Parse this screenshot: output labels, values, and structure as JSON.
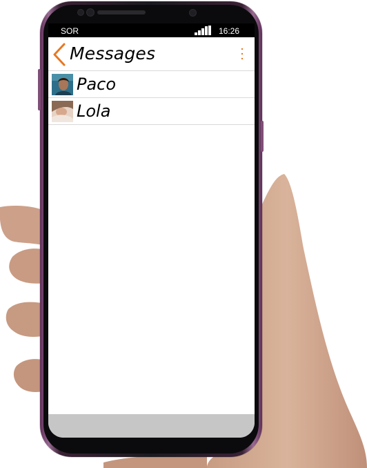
{
  "status_bar": {
    "carrier": "SOR",
    "time": "16:26"
  },
  "header": {
    "title": "Messages",
    "back_icon": "chevron-left-icon",
    "menu_icon": "vertical-dots-icon"
  },
  "conversations": [
    {
      "name": "Paco",
      "avatar": "avatar-photo"
    },
    {
      "name": "Lola",
      "avatar": "avatar-photo"
    }
  ],
  "colors": {
    "accent": "#e87722",
    "divider": "#d9d9d9",
    "bottom_bar": "#c6c6c6"
  }
}
